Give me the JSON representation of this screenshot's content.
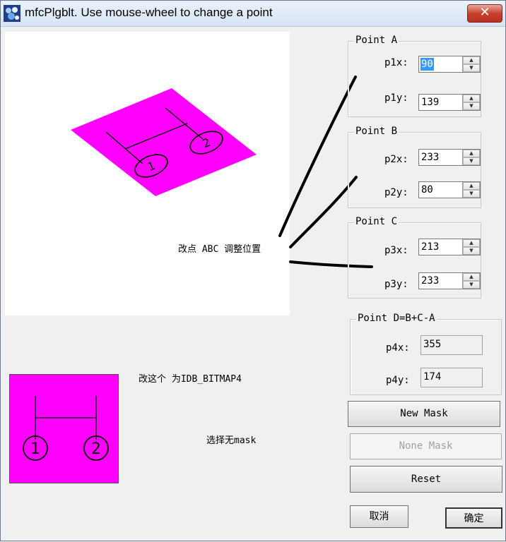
{
  "window": {
    "title": "mfcPlgblt. Use mouse-wheel to change a point",
    "close_label": "✕"
  },
  "canvas": {
    "label": "改点 ABC 调整位置",
    "circle_1": "1",
    "circle_2": "2"
  },
  "thumbnail": {
    "label_bitmap": "改这个 为IDB_BITMAP4",
    "label_mask": "选择无mask",
    "circle_1": "1",
    "circle_2": "2"
  },
  "point_a": {
    "title": "Point A",
    "p1x_label": "p1x:",
    "p1x_value": "90",
    "p1y_label": "p1y:",
    "p1y_value": "139"
  },
  "point_b": {
    "title": "Point B",
    "p2x_label": "p2x:",
    "p2x_value": "233",
    "p2y_label": "p2y:",
    "p2y_value": "80"
  },
  "point_c": {
    "title": "Point C",
    "p3x_label": "p3x:",
    "p3x_value": "213",
    "p3y_label": "p3y:",
    "p3y_value": "233"
  },
  "point_d": {
    "title": "Point D=B+C-A",
    "p4x_label": "p4x:",
    "p4x_value": "355",
    "p4y_label": "p4y:",
    "p4y_value": "174"
  },
  "buttons": {
    "new_mask": "New Mask",
    "none_mask": "None Mask",
    "reset": "Reset",
    "cancel": "取消",
    "ok": "确定"
  },
  "colors": {
    "shape_fill": "#ff00ff",
    "selection": "#3399ff"
  },
  "icons": {
    "app": "app-icon",
    "spin_up": "spin-up-arrow-icon",
    "spin_down": "spin-down-arrow-icon",
    "close": "close-icon"
  }
}
